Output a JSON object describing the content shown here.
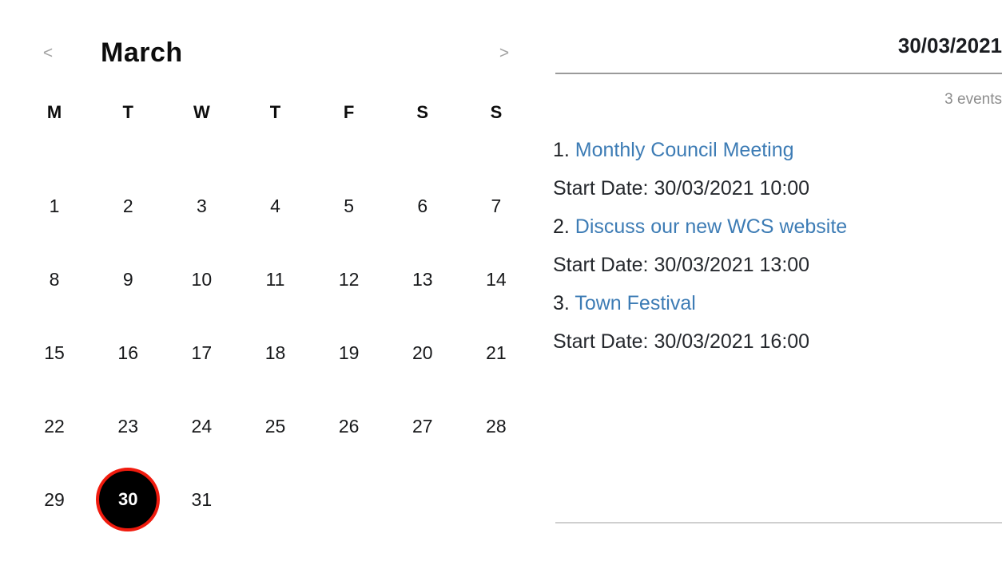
{
  "accent_colors": {
    "selected_day_fill": "#000000",
    "selected_day_ring": "#f01b0e",
    "event_link": "#3d7cb5",
    "muted_text": "#8d8d8d",
    "rule_top": "#9a9a9a",
    "rule_bottom": "#cfcfcf"
  },
  "calendar": {
    "month_label": "March",
    "prev_icon": "chevron-left-icon",
    "prev_label": "<",
    "next_icon": "chevron-right-icon",
    "next_label": ">",
    "weekdays": [
      "M",
      "T",
      "W",
      "T",
      "F",
      "S",
      "S"
    ],
    "leading_blanks": 0,
    "days": [
      {
        "num": "1",
        "selected": false
      },
      {
        "num": "2",
        "selected": false
      },
      {
        "num": "3",
        "selected": false
      },
      {
        "num": "4",
        "selected": false
      },
      {
        "num": "5",
        "selected": false
      },
      {
        "num": "6",
        "selected": false
      },
      {
        "num": "7",
        "selected": false
      },
      {
        "num": "8",
        "selected": false
      },
      {
        "num": "9",
        "selected": false
      },
      {
        "num": "10",
        "selected": false
      },
      {
        "num": "11",
        "selected": false
      },
      {
        "num": "12",
        "selected": false
      },
      {
        "num": "13",
        "selected": false
      },
      {
        "num": "14",
        "selected": false
      },
      {
        "num": "15",
        "selected": false
      },
      {
        "num": "16",
        "selected": false
      },
      {
        "num": "17",
        "selected": false
      },
      {
        "num": "18",
        "selected": false
      },
      {
        "num": "19",
        "selected": false
      },
      {
        "num": "20",
        "selected": false
      },
      {
        "num": "21",
        "selected": false
      },
      {
        "num": "22",
        "selected": false
      },
      {
        "num": "23",
        "selected": false
      },
      {
        "num": "24",
        "selected": false
      },
      {
        "num": "25",
        "selected": false
      },
      {
        "num": "26",
        "selected": false
      },
      {
        "num": "27",
        "selected": false
      },
      {
        "num": "28",
        "selected": false
      },
      {
        "num": "29",
        "selected": false
      },
      {
        "num": "30",
        "selected": true
      },
      {
        "num": "31",
        "selected": false
      }
    ],
    "selected_day": "30"
  },
  "detail": {
    "date_heading": "30/03/2021",
    "event_count_label": "3 events",
    "start_date_prefix": "Start Date: ",
    "events": [
      {
        "index_label": "1. ",
        "title": "Monthly Council Meeting",
        "start_date": "30/03/2021 10:00"
      },
      {
        "index_label": "2. ",
        "title": "Discuss our new WCS website",
        "start_date": "30/03/2021 13:00"
      },
      {
        "index_label": "3. ",
        "title": "Town Festival",
        "start_date": "30/03/2021 16:00"
      }
    ]
  }
}
